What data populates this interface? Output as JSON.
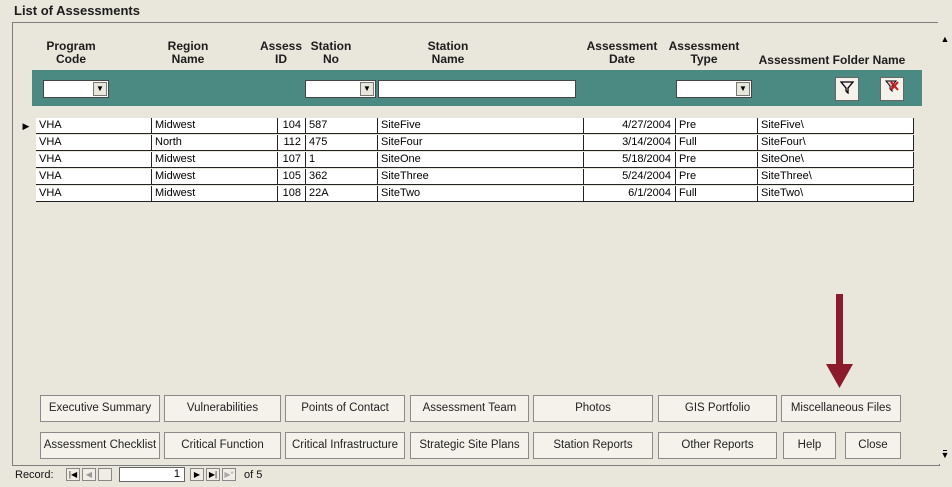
{
  "window": {
    "title": "List of Assessments"
  },
  "columns": [
    {
      "label": "Program\nCode"
    },
    {
      "label": "Region\nName"
    },
    {
      "label": "Assess\nID"
    },
    {
      "label": "Station\nNo"
    },
    {
      "label": "Station\nName"
    },
    {
      "label": "Assessment\nDate"
    },
    {
      "label": "Assessment\nType"
    },
    {
      "label": "Assessment Folder Name"
    }
  ],
  "filter": {
    "program_code": "",
    "station_no": "",
    "station_name": "",
    "assessment_type": ""
  },
  "toolbar": {
    "filter_icon": "filter-icon",
    "clear_filter_icon": "clear-filter-icon"
  },
  "rows": [
    {
      "program": "VHA",
      "region": "Midwest",
      "id": "104",
      "station_no": "587",
      "station_name": "SiteFive",
      "date": "4/27/2004",
      "type": "Pre",
      "folder": "SiteFive\\"
    },
    {
      "program": "VHA",
      "region": "North",
      "id": "112",
      "station_no": "475",
      "station_name": "SiteFour",
      "date": "3/14/2004",
      "type": "Full",
      "folder": "SiteFour\\"
    },
    {
      "program": "VHA",
      "region": "Midwest",
      "id": "107",
      "station_no": "1",
      "station_name": "SiteOne",
      "date": "5/18/2004",
      "type": "Pre",
      "folder": "SiteOne\\"
    },
    {
      "program": "VHA",
      "region": "Midwest",
      "id": "105",
      "station_no": "362",
      "station_name": "SiteThree",
      "date": "5/24/2004",
      "type": "Pre",
      "folder": "SiteThree\\"
    },
    {
      "program": "VHA",
      "region": "Midwest",
      "id": "108",
      "station_no": "22A",
      "station_name": "SiteTwo",
      "date": "6/1/2004",
      "type": "Full",
      "folder": "SiteTwo\\"
    }
  ],
  "buttons_row1": [
    "Executive Summary",
    "Vulnerabilities",
    "Points of Contact",
    "Assessment Team",
    "Photos",
    "GIS Portfolio",
    "Miscellaneous Files"
  ],
  "buttons_row2": [
    "Assessment Checklist",
    "Critical Function",
    "Critical Infrastructure",
    "Strategic Site Plans",
    "Station Reports",
    "Other Reports",
    "Help",
    "Close"
  ],
  "record_nav": {
    "label": "Record:",
    "current": "1",
    "of_text": "of 5"
  },
  "colors": {
    "header_band": "#4a8a82",
    "arrow": "#8b1a2b"
  }
}
